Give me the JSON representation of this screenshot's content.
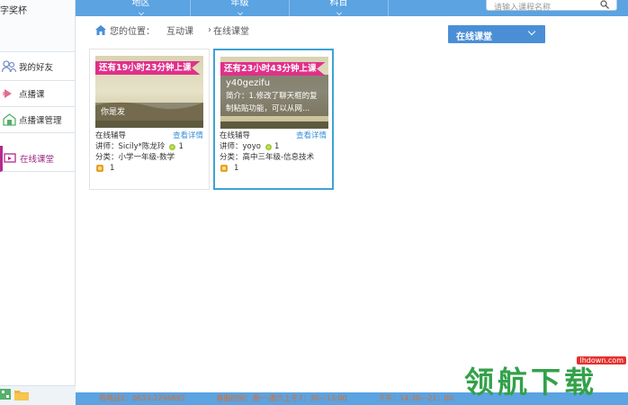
{
  "sidebar": {
    "user_name": "字奖杯",
    "items": [
      {
        "label": "我的好友",
        "icon": "friends-icon"
      },
      {
        "label": "点播课",
        "icon": "vod-icon"
      },
      {
        "label": "点播课管理",
        "icon": "vod-manage-icon"
      },
      {
        "label": "在线课堂",
        "icon": "online-class-icon",
        "active": true
      }
    ]
  },
  "topbar": {
    "tabs": [
      "地区",
      "年级",
      "科目"
    ],
    "search_placeholder": "请输入课程名称"
  },
  "breadcrumb": {
    "prefix": "您的位置：",
    "level1": "互动课",
    "level2": "在线课堂"
  },
  "dropdown": {
    "value": "在线课堂"
  },
  "cards": [
    {
      "countdown": "还有19小时23分钟上课",
      "thumb_line1": "",
      "thumb_line2": "你是发",
      "type": "在线辅导",
      "detail_link": "查看详情",
      "teacher": "讲师：Sicily*陈龙玲",
      "flowers": "1",
      "category": "分类：小学一年级-数学",
      "medals": "1"
    },
    {
      "countdown": "还有23小时43分钟上课",
      "thumb_line1": "y40gezifu",
      "thumb_line2": "简介：1.修改了聊天框的复制粘贴功能，可以从网...",
      "type": "在线辅导",
      "detail_link": "查看详情",
      "teacher": "讲师：yoyo",
      "flowers": "1",
      "category": "分类：高中三年级-信息技术",
      "medals": "1"
    }
  ],
  "footer": {
    "phone": "热电话2：0633-2296692",
    "hours1": "客服时间：周一-周六上午7：30—13:00",
    "hours2": "下午：14:30—21：00"
  },
  "watermark": {
    "text": "领航下载",
    "url": "lhdown.com"
  },
  "colors": {
    "accent": "#5ba3e1",
    "ribbon": "#e0308a",
    "active": "#b22a8e",
    "link": "#3b8fd8"
  }
}
